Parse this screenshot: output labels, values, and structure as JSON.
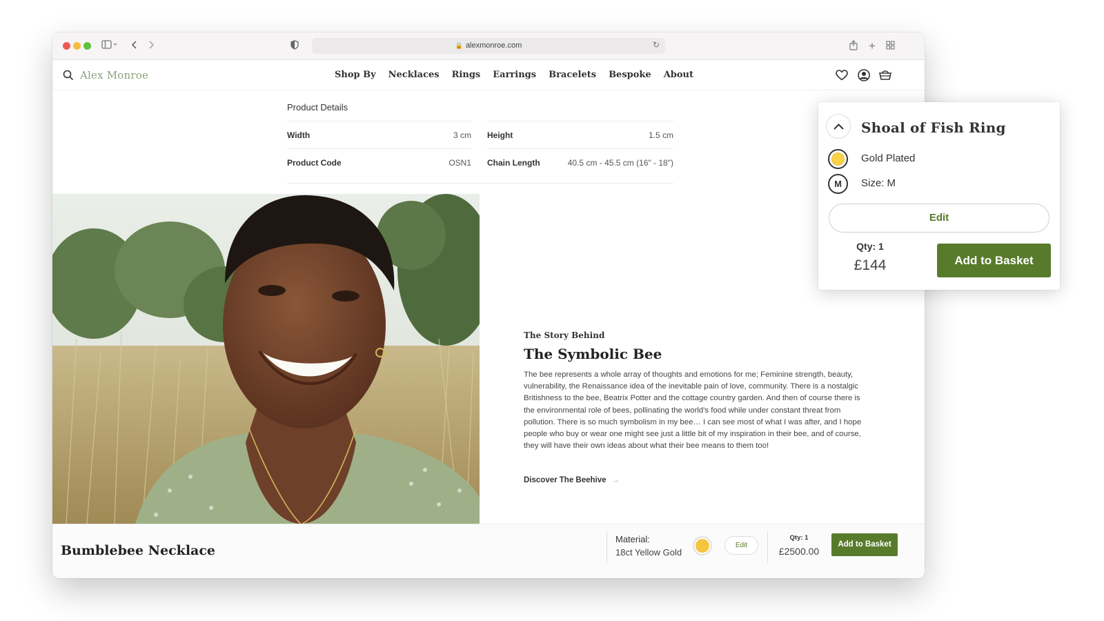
{
  "browser": {
    "url": "alexmonroe.com"
  },
  "nav": {
    "logo": "Alex Monroe",
    "menu": [
      "Shop By",
      "Necklaces",
      "Rings",
      "Earrings",
      "Bracelets",
      "Bespoke",
      "About"
    ]
  },
  "product_details": {
    "title": "Product Details",
    "rows": [
      {
        "label": "Width",
        "value": "3 cm"
      },
      {
        "label": "Height",
        "value": "1.5 cm"
      },
      {
        "label": "Product Code",
        "value": "OSN1"
      },
      {
        "label": "Chain Length",
        "value": "40.5 cm - 45.5 cm (16\" - 18\")"
      }
    ]
  },
  "story": {
    "kicker": "The Story Behind",
    "title": "The Symbolic Bee",
    "body": "The bee represents a whole array of thoughts and emotions for me; Feminine strength, beauty, vulnerability, the Renaissance idea of the inevitable pain of love, community. There is a nostalgic Britishness to the bee, Beatrix Potter and the cottage country garden. And then of course there is the environmental role of bees, pollinating the world's food while under constant threat from pollution. There is so much symbolism in my bee… I can see most of what I was after, and I hope people who buy or wear one might see just a little bit of my inspiration in their bee, and of course, they will have their own ideas about what their bee means to them too!",
    "link": "Discover The Beehive",
    "link_arrow": "→"
  },
  "sticky_bar": {
    "product_name": "Bumblebee Necklace",
    "material_label": "Material:",
    "material_value": "18ct Yellow Gold",
    "edit": "Edit",
    "qty": "Qty: 1",
    "price": "£2500.00",
    "add": "Add to Basket"
  },
  "popover": {
    "title": "Shoal of Fish Ring",
    "material": "Gold Plated",
    "size_badge": "M",
    "size": "Size: M",
    "edit": "Edit",
    "qty": "Qty: 1",
    "price": "£144",
    "add": "Add to Basket"
  },
  "colors": {
    "brand_green": "#587a2b",
    "logo_green": "#8ca37c",
    "gold_swatch": "#f5c542"
  }
}
